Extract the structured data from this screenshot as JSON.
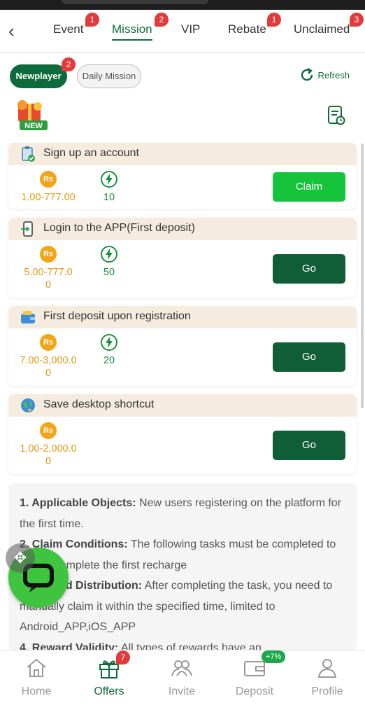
{
  "tabs": [
    {
      "label": "Event",
      "badge": "1"
    },
    {
      "label": "Mission",
      "badge": "2",
      "active": true
    },
    {
      "label": "VIP"
    },
    {
      "label": "Rebate",
      "badge": "1"
    },
    {
      "label": "Unclaimed",
      "badge": "3"
    }
  ],
  "subtabs": {
    "newplayer": "Newplayer",
    "newplayer_badge": "2",
    "daily": "Daily Mission"
  },
  "refresh_label": "Refresh",
  "new_badge": "NEW",
  "coin_symbol": "Rs",
  "missions": [
    {
      "title": "Sign up an account",
      "amount": "1.00-777.00",
      "points": "10",
      "button": "Claim"
    },
    {
      "title": "Login to the APP(First deposit)",
      "amount": "5.00-777.00",
      "points": "50",
      "button": "Go"
    },
    {
      "title": "First deposit upon registration",
      "amount": "7.00-3,000.00",
      "points": "20",
      "button": "Go"
    },
    {
      "title": "Save desktop shortcut",
      "amount": "1.00-2,000.00",
      "button": "Go"
    }
  ],
  "rules": [
    {
      "head": "1. Applicable Objects:",
      "text": " New users registering on the platform for the first time."
    },
    {
      "head": "2. Claim Conditions:",
      "text": " The following tasks must be completed to claim: Complete the first recharge"
    },
    {
      "head": "3. Reward Distribution:",
      "text": " After completing the task, you need to manually claim it within the specified time, limited to Android_APP,iOS_APP"
    },
    {
      "head": "4. Reward Validity:",
      "text": " All types of rewards have an"
    }
  ],
  "nav": [
    {
      "label": "Home",
      "icon": "home-icon"
    },
    {
      "label": "Offers",
      "icon": "gift-icon",
      "badge": "7",
      "active": true
    },
    {
      "label": "Invite",
      "icon": "people-icon"
    },
    {
      "label": "Deposit",
      "icon": "wallet-icon",
      "badge": "+7%"
    },
    {
      "label": "Profile",
      "icon": "person-icon"
    }
  ],
  "colors": {
    "brand": "#0e6b3b",
    "claim": "#16c43b",
    "go": "#0f5e37",
    "coin": "#f3a51a",
    "badge": "#e23b3b"
  }
}
